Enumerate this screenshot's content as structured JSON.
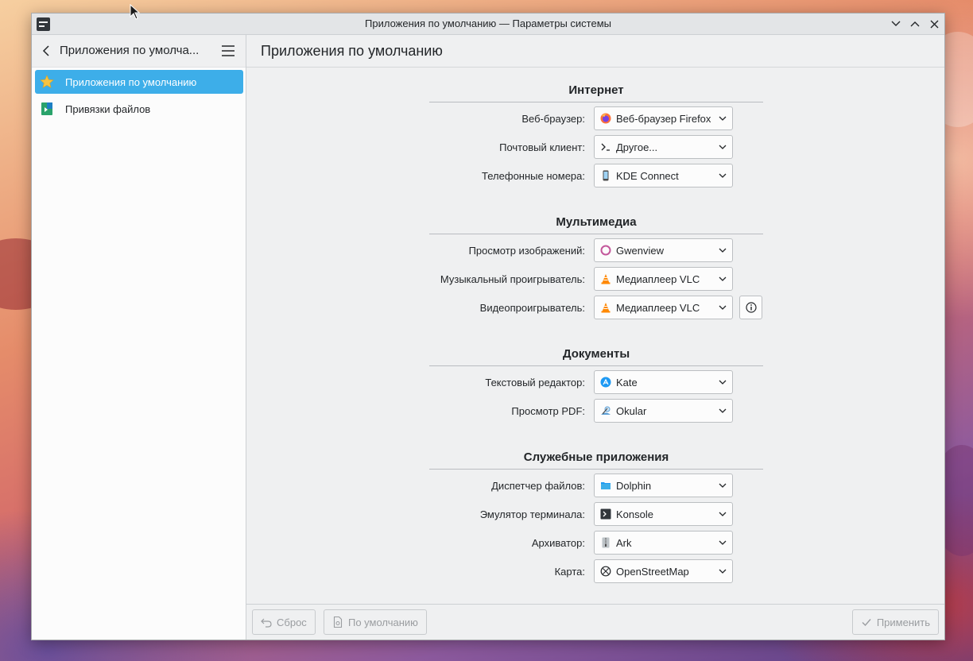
{
  "window": {
    "title": "Приложения по умолчанию — Параметры системы"
  },
  "sidebar": {
    "title": "Приложения по умолча...",
    "items": [
      {
        "label": "Приложения по умолчанию",
        "icon": "star-icon",
        "active": true
      },
      {
        "label": "Привязки файлов",
        "icon": "file-associations-icon",
        "active": false
      }
    ]
  },
  "main": {
    "title": "Приложения по умолчанию"
  },
  "sections": {
    "internet": {
      "title": "Интернет",
      "rows": [
        {
          "label": "Веб-браузер:",
          "value": "Веб-браузер Firefox",
          "icon": "firefox-icon"
        },
        {
          "label": "Почтовый клиент:",
          "value": "Другое...",
          "icon": "terminal-prompt-icon"
        },
        {
          "label": "Телефонные номера:",
          "value": "KDE Connect",
          "icon": "phone-icon"
        }
      ]
    },
    "multimedia": {
      "title": "Мультимедиа",
      "rows": [
        {
          "label": "Просмотр изображений:",
          "value": "Gwenview",
          "icon": "gwenview-icon"
        },
        {
          "label": "Музыкальный проигрыватель:",
          "value": "Медиаплеер VLC",
          "icon": "vlc-icon"
        },
        {
          "label": "Видеопроигрыватель:",
          "value": "Медиаплеер VLC",
          "icon": "vlc-icon"
        }
      ]
    },
    "documents": {
      "title": "Документы",
      "rows": [
        {
          "label": "Текстовый редактор:",
          "value": "Kate",
          "icon": "kate-icon"
        },
        {
          "label": "Просмотр PDF:",
          "value": "Okular",
          "icon": "okular-icon"
        }
      ]
    },
    "utilities": {
      "title": "Служебные приложения",
      "rows": [
        {
          "label": "Диспетчер файлов:",
          "value": "Dolphin",
          "icon": "dolphin-folder-icon"
        },
        {
          "label": "Эмулятор терминала:",
          "value": "Konsole",
          "icon": "konsole-icon"
        },
        {
          "label": "Архиватор:",
          "value": "Ark",
          "icon": "ark-icon"
        },
        {
          "label": "Карта:",
          "value": "OpenStreetMap",
          "icon": "map-icon"
        }
      ]
    }
  },
  "footer": {
    "reset_label": "Сброс",
    "defaults_label": "По умолчанию",
    "apply_label": "Применить"
  },
  "colors": {
    "accent": "#3daee9",
    "window_bg": "#eff0f1",
    "text": "#232629",
    "disabled_text": "#9a9da0"
  }
}
